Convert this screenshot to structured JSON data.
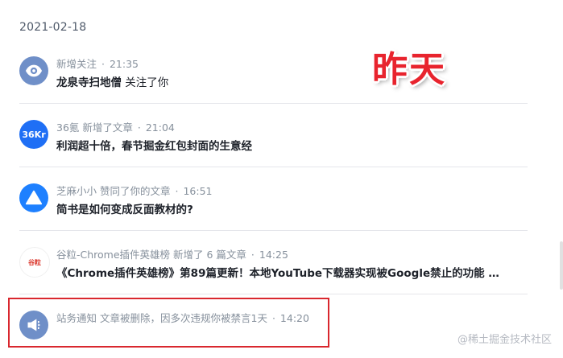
{
  "date_header": "2021-02-18",
  "overlay_label": "昨天",
  "watermark": "@稀土掘金技术社区",
  "items": [
    {
      "avatar_icon": "eye-icon",
      "user": "新增关注",
      "action": "",
      "separator": "·",
      "time": "21:35",
      "title_bold": "龙泉寺扫地僧",
      "title_plain": " 关注了你"
    },
    {
      "avatar_icon": "36kr-logo",
      "avatar_text": "36Kr",
      "user": "36氪",
      "action": "新增了文章",
      "separator": "·",
      "time": "21:04",
      "title_bold": "利润超十倍，春节掘金红包封面的生意经",
      "title_plain": ""
    },
    {
      "avatar_icon": "triangle-icon",
      "user": "芝麻小小",
      "action": "赞同了你的文章",
      "separator": "·",
      "time": "16:51",
      "title_bold": "简书是如何变成反面教材的?",
      "title_plain": ""
    },
    {
      "avatar_icon": "chrome-hero-logo",
      "avatar_text": "谷粒",
      "user": "谷粒-Chrome插件英雄榜",
      "action": "新增了 6 篇文章",
      "separator": "·",
      "time": "14:25",
      "title_bold": "《Chrome插件英雄榜》第89篇更新！本地YouTube下载器实现被Google禁止的功能 等...",
      "title_plain": ""
    },
    {
      "avatar_icon": "megaphone-icon",
      "user": "站务通知",
      "action": "文章被删除，因多次违规你被禁言1天",
      "separator": "·",
      "time": "14:20",
      "title_bold": "",
      "title_plain": ""
    }
  ],
  "colors": {
    "accent_red": "#e8242e",
    "highlight_border": "#d9272e",
    "meta_gray": "#86909c"
  }
}
